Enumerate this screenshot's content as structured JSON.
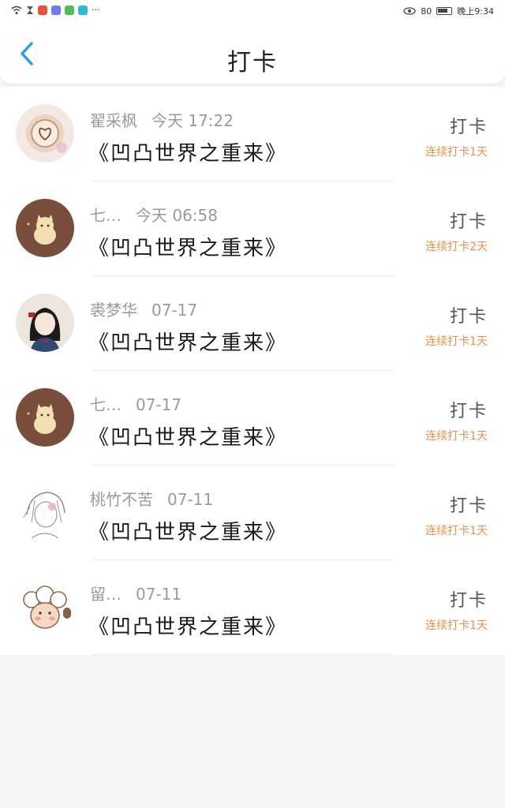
{
  "status_bar": {
    "battery": "80",
    "time": "晚上9:34"
  },
  "header": {
    "title": "打卡"
  },
  "checkins": [
    {
      "name": "翟采枫",
      "time": "今天 17:22",
      "book": "《凹凸世界之重来》",
      "action": "打卡",
      "streak": "连续打卡1天",
      "avatar": "latte-avatar"
    },
    {
      "name": "七…",
      "time": "今天 06:58",
      "book": "《凹凸世界之重来》",
      "action": "打卡",
      "streak": "连续打卡2天",
      "avatar": "cat-avatar"
    },
    {
      "name": "裘梦华",
      "time": "07-17",
      "book": "《凹凸世界之重来》",
      "action": "打卡",
      "streak": "连续打卡1天",
      "avatar": "girl-avatar"
    },
    {
      "name": "七…",
      "time": "07-17",
      "book": "《凹凸世界之重来》",
      "action": "打卡",
      "streak": "连续打卡1天",
      "avatar": "cat-avatar"
    },
    {
      "name": "桃竹不苦",
      "time": "07-11",
      "book": "《凹凸世界之重来》",
      "action": "打卡",
      "streak": "连续打卡1天",
      "avatar": "sketch-avatar"
    },
    {
      "name": "留…",
      "time": "07-11",
      "book": "《凹凸世界之重来》",
      "action": "打卡",
      "streak": "连续打卡1天",
      "avatar": "sheep-avatar"
    }
  ],
  "colors": {
    "accent_blue": "#2a9cf0",
    "streak_orange": "#e8904f",
    "cat_bg": "#7a4e3c"
  }
}
